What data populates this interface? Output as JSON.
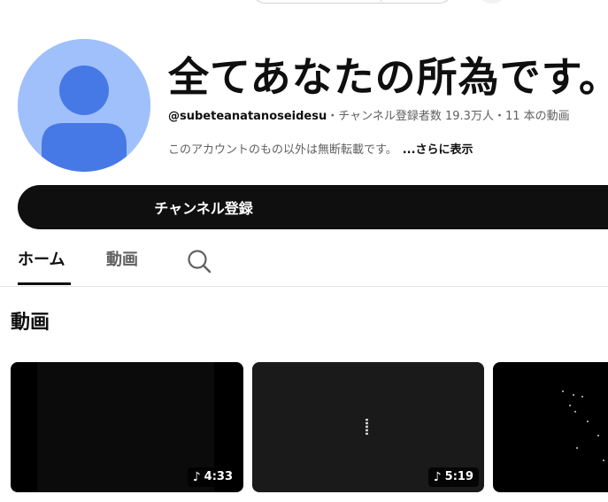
{
  "channel": {
    "title": "全てあなたの所為です。",
    "handle": "@subeteanatanoseidesu",
    "separator": "・",
    "subscribers": "チャンネル登録者数 19.3万人",
    "video_count": "11 本の動画",
    "description": "このアカウントのもの以外は無断転載です。",
    "more_label": "...さらに表示",
    "subscribe_label": "チャンネル登録",
    "avatar_color": "#a0c0fb",
    "avatar_figure_color": "#4679e5"
  },
  "tabs": [
    {
      "label": "ホーム",
      "active": true
    },
    {
      "label": "動画",
      "active": false
    }
  ],
  "tab_search_icon": "search-icon",
  "section": {
    "title": "動画"
  },
  "videos": [
    {
      "duration": "4:33",
      "badge_icon": "music-note-icon"
    },
    {
      "duration": "5:19",
      "badge_icon": "music-note-icon"
    },
    {
      "duration": "",
      "badge_icon": ""
    }
  ],
  "colors": {
    "text_primary": "#0f0f0f",
    "text_secondary": "#606060",
    "button_bg": "#0f0f0f",
    "divider": "#e5e5e5"
  }
}
